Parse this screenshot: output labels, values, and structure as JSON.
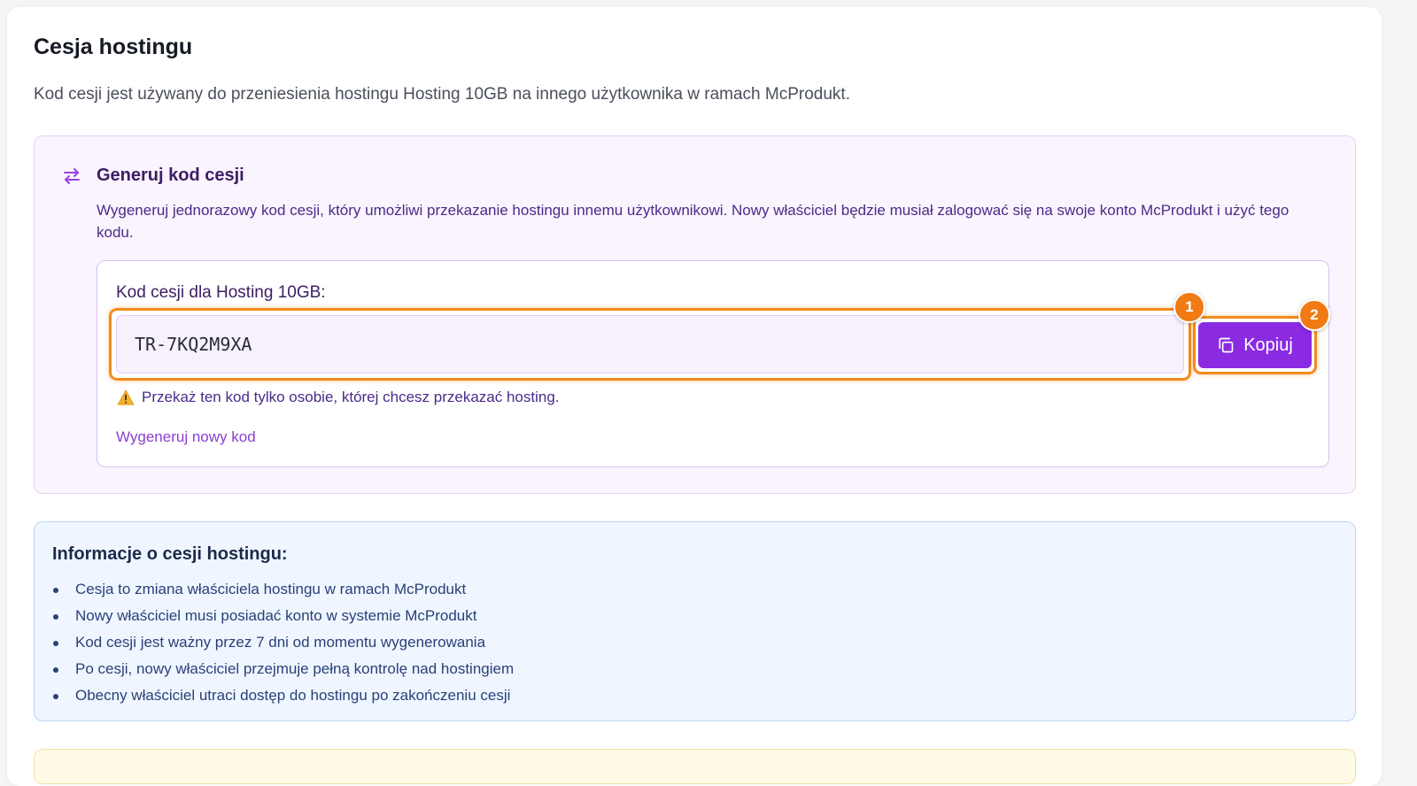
{
  "page": {
    "title": "Cesja hostingu",
    "description": "Kod cesji jest używany do przeniesienia hostingu Hosting 10GB na innego użytkownika w ramach McProdukt."
  },
  "generate": {
    "icon": "transfer-arrows-icon",
    "title": "Generuj kod cesji",
    "description": "Wygeneruj jednorazowy kod cesji, który umożliwi przekazanie hostingu innemu użytkownikowi. Nowy właściciel będzie musiał zalogować się na swoje konto McProdukt i użyć tego kodu.",
    "code_label": "Kod cesji dla Hosting 10GB:",
    "code_value": "TR-7KQ2M9XA",
    "copy_label": "Kopiuj",
    "copy_icon": "copy-icon",
    "warning_icon": "warning-icon",
    "warning": "Przekaż ten kod tylko osobie, której chcesz przekazać hosting.",
    "regenerate_label": "Wygeneruj nowy kod"
  },
  "annotations": {
    "badge_1": "1",
    "badge_2": "2"
  },
  "info": {
    "title": "Informacje o cesji hostingu:",
    "items": [
      "Cesja to zmiana właściciela hostingu w ramach McProdukt",
      "Nowy właściciel musi posiadać konto w systemie McProdukt",
      "Kod cesji jest ważny przez 7 dni od momentu wygenerowania",
      "Po cesji, nowy właściciel przejmuje pełną kontrolę nad hostingiem",
      "Obecny właściciel utraci dostęp do hostingu po zakończeniu cesji"
    ]
  },
  "colors": {
    "accent": "#8a2be2",
    "highlight": "#f28b1e",
    "info_bg": "#eff6ff",
    "generate_bg": "#faf4fe"
  }
}
